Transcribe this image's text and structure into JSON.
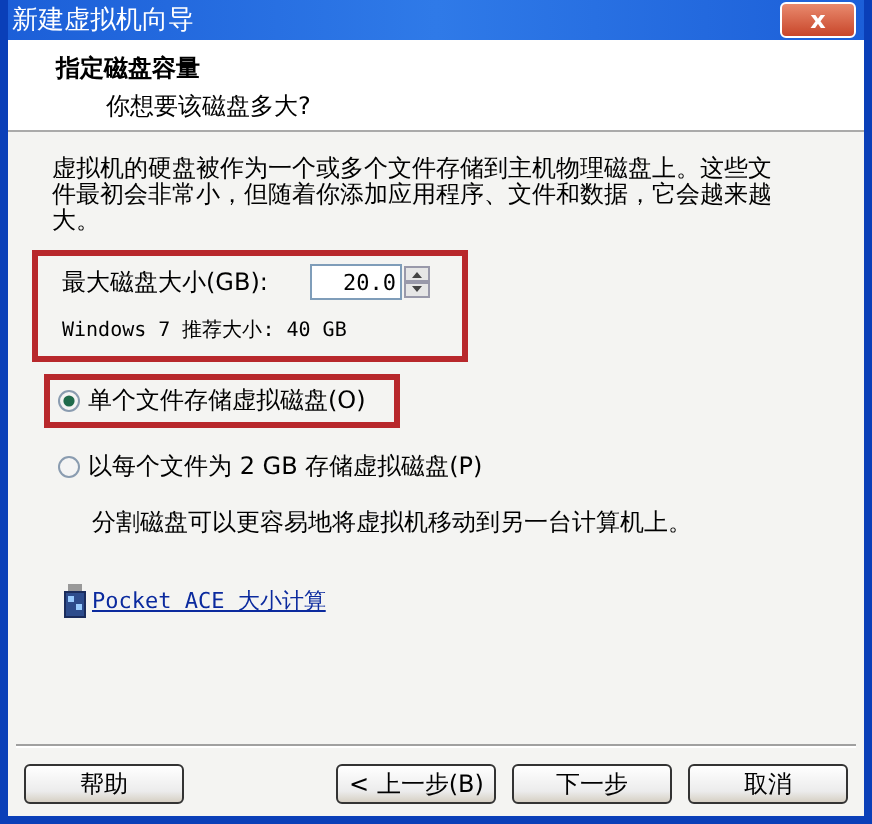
{
  "window": {
    "title": "新建虚拟机向导",
    "close": "x"
  },
  "header": {
    "title": "指定磁盘容量",
    "subtitle": "你想要该磁盘多大?"
  },
  "description": "虚拟机的硬盘被作为一个或多个文件存储到主机物理磁盘上。这些文件最初会非常小，但随着你添加应用程序、文件和数据，它会越来越大。",
  "size_field": {
    "label": "最大磁盘大小(GB):",
    "value": "20.0",
    "recommendation": "Windows 7 推荐大小: 40 GB",
    "highlighted": true
  },
  "options": [
    {
      "label": "单个文件存储虚拟磁盘(O)",
      "selected": true,
      "highlighted": true
    },
    {
      "label": "以每个文件为 2 GB 存储虚拟磁盘(P)",
      "selected": false,
      "highlighted": false,
      "note": "分割磁盘可以更容易地将虚拟机移动到另一台计算机上。"
    }
  ],
  "link": "Pocket ACE 大小计算",
  "buttons": [
    {
      "label": "帮助",
      "kind": "help"
    },
    {
      "label": "< 上一步(B)",
      "kind": "nav"
    },
    {
      "label": "下一步",
      "kind": "nav"
    },
    {
      "label": "取消",
      "kind": "nav"
    }
  ]
}
